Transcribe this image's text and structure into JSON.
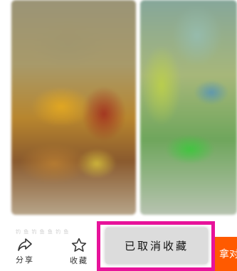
{
  "content": {
    "caption_faint": "钓 鱼 钓 鱼 鱼 钓 鱼"
  },
  "actions": {
    "share_label": "分享",
    "share_icon": "share-icon",
    "favorite_label": "收藏",
    "favorite_icon": "star-icon"
  },
  "toast": {
    "message": "已取消收藏",
    "highlight_color": "#e7139a"
  },
  "cta": {
    "label_partial": "拿对",
    "color": "#ff5a00"
  }
}
